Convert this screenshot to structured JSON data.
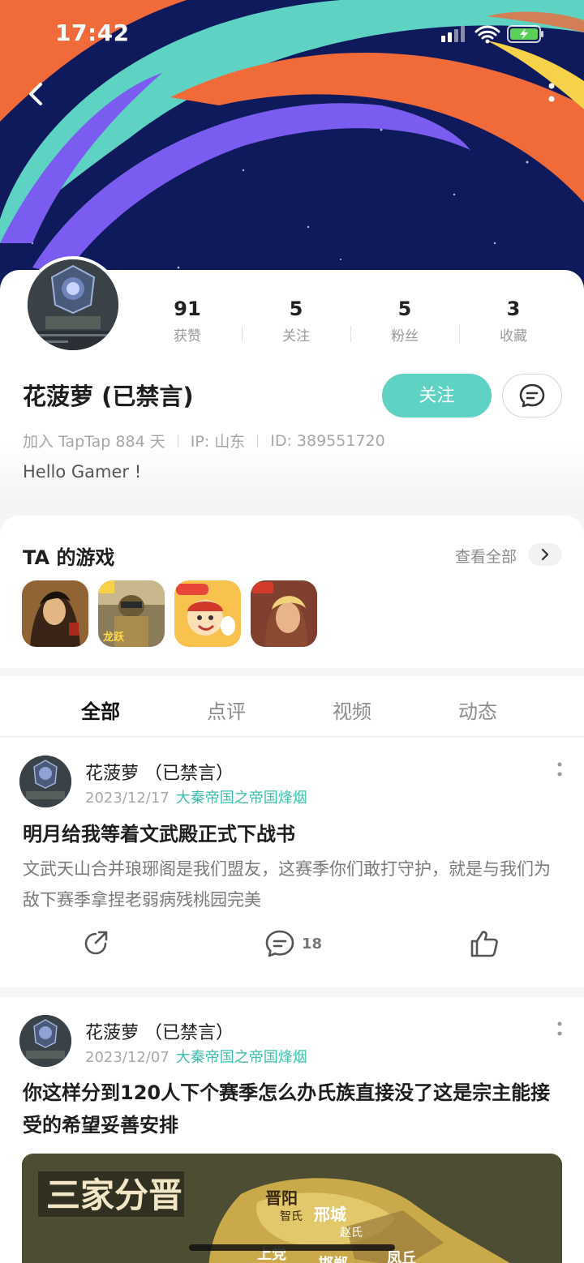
{
  "status_bar": {
    "time": "17:42"
  },
  "profile": {
    "name": "花菠萝 (已禁言)",
    "stats": [
      {
        "value": "91",
        "label": "获赞"
      },
      {
        "value": "5",
        "label": "关注"
      },
      {
        "value": "5",
        "label": "粉丝"
      },
      {
        "value": "3",
        "label": "收藏"
      }
    ],
    "follow_label": "关注",
    "meta": {
      "joined": "加入 TapTap 884 天",
      "ip": "IP: 山东",
      "id": "ID: 389551720"
    },
    "bio": "Hello Gamer !"
  },
  "games_section": {
    "title": "TA 的游戏",
    "view_all": "查看全部"
  },
  "tabs": [
    "全部",
    "点评",
    "视频",
    "动态"
  ],
  "posts": [
    {
      "author": "花菠萝 （已禁言）",
      "date": "2023/12/17",
      "game": "大秦帝国之帝国烽烟",
      "title": "明月给我等着文武殿正式下战书",
      "body": "文武天山合并琅琊阁是我们盟友，这赛季你们敢打守护，就是与我们为敌下赛季拿捏老弱病残桃园完美",
      "comment_count": "18"
    },
    {
      "author": "花菠萝 （已禁言）",
      "date": "2023/12/07",
      "game": "大秦帝国之帝国烽烟",
      "title": "你这样分到120人下个赛季怎么办氏族直接没了这是宗主能接受的希望妥善安排",
      "image_text": "三家分晋",
      "map_labels": [
        "晋阳",
        "智氏",
        "邢城",
        "赵氏",
        "邯郸",
        "上党",
        "凤丘"
      ]
    }
  ],
  "colors": {
    "accent": "#5fd3c3",
    "game_link": "#3cbfae",
    "hero_bg": "#0f1a5c"
  }
}
